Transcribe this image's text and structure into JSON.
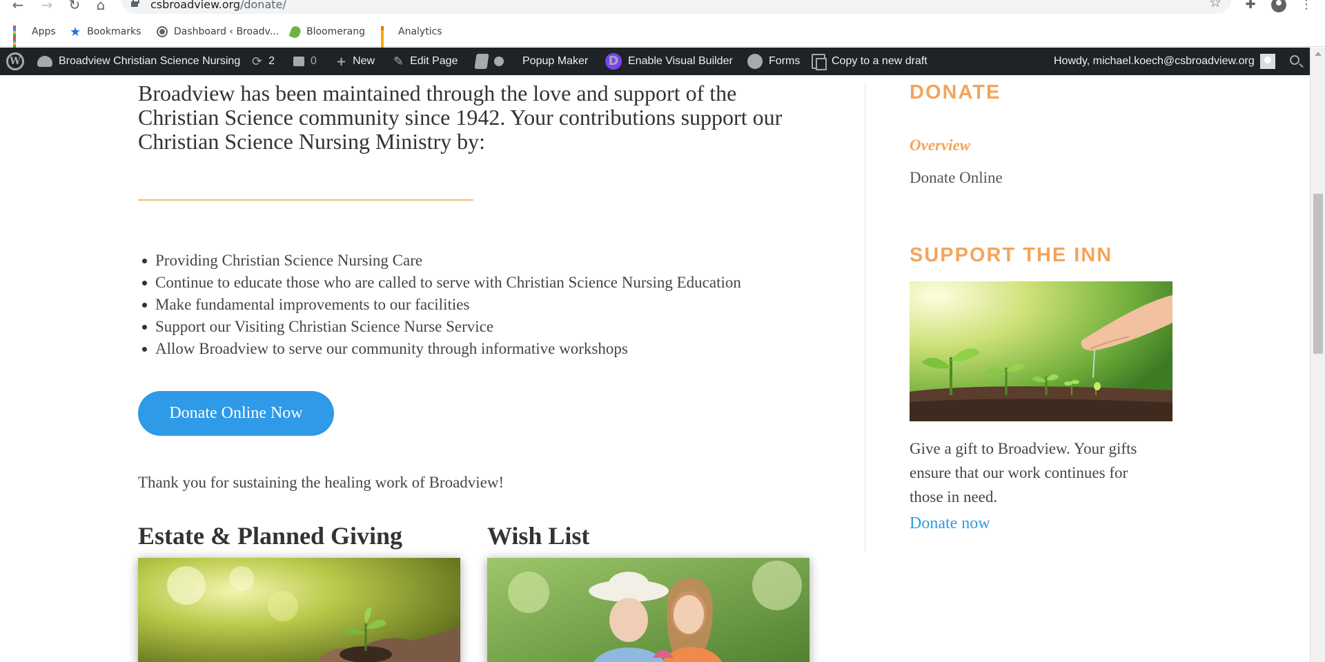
{
  "browser": {
    "url_host": "csbroadview.org",
    "url_path": "/donate/",
    "bookmarks": [
      {
        "label": "Apps",
        "icon": "apps-grid-icon"
      },
      {
        "label": "Bookmarks",
        "icon": "star-icon"
      },
      {
        "label": "Dashboard ‹ Broadv...",
        "icon": "globe-icon"
      },
      {
        "label": "Bloomerang",
        "icon": "leaf-icon"
      },
      {
        "label": "Analytics",
        "icon": "analytics-bars-icon"
      }
    ]
  },
  "adminbar": {
    "site_name": "Broadview Christian Science Nursing",
    "updates_count": "2",
    "comments_count": "0",
    "new_label": "New",
    "edit_label": "Edit Page",
    "popup_label": "Popup Maker",
    "visual_builder_label": "Enable Visual Builder",
    "forms_label": "Forms",
    "copy_label": "Copy to a new draft",
    "howdy": "Howdy, michael.koech@csbroadview.org"
  },
  "main": {
    "intro": "Broadview has been maintained through the love and support of the Christian Science community since 1942. Your contributions support our Christian Science Nursing Ministry by:",
    "bullets": [
      "Providing Christian Science Nursing Care",
      "Continue to educate those who are called to serve with Christian Science Nursing Education",
      "Make fundamental improvements to our facilities",
      "Support our Visiting Christian Science Nurse Service",
      "Allow Broadview to serve our community through informative workshops"
    ],
    "donate_button": "Donate Online Now",
    "thanks": "Thank you for sustaining the healing work of Broadview!",
    "estate_heading": "Estate & Planned Giving",
    "wishlist_heading": "Wish List"
  },
  "sidebar": {
    "donate_heading": "DONATE",
    "links": [
      {
        "label": "Overview",
        "active": true
      },
      {
        "label": "Donate Online",
        "active": false
      }
    ],
    "support_heading": "SUPPORT THE INN",
    "support_text": "Give a gift to Broadview. Your gifts ensure that our work continues for those in need.",
    "support_link": "Donate now"
  },
  "colors": {
    "accent_orange": "#f4a45a",
    "button_blue": "#2e9ae8",
    "adminbar_bg": "#1d2327",
    "divi_purple": "#7b43f0"
  }
}
